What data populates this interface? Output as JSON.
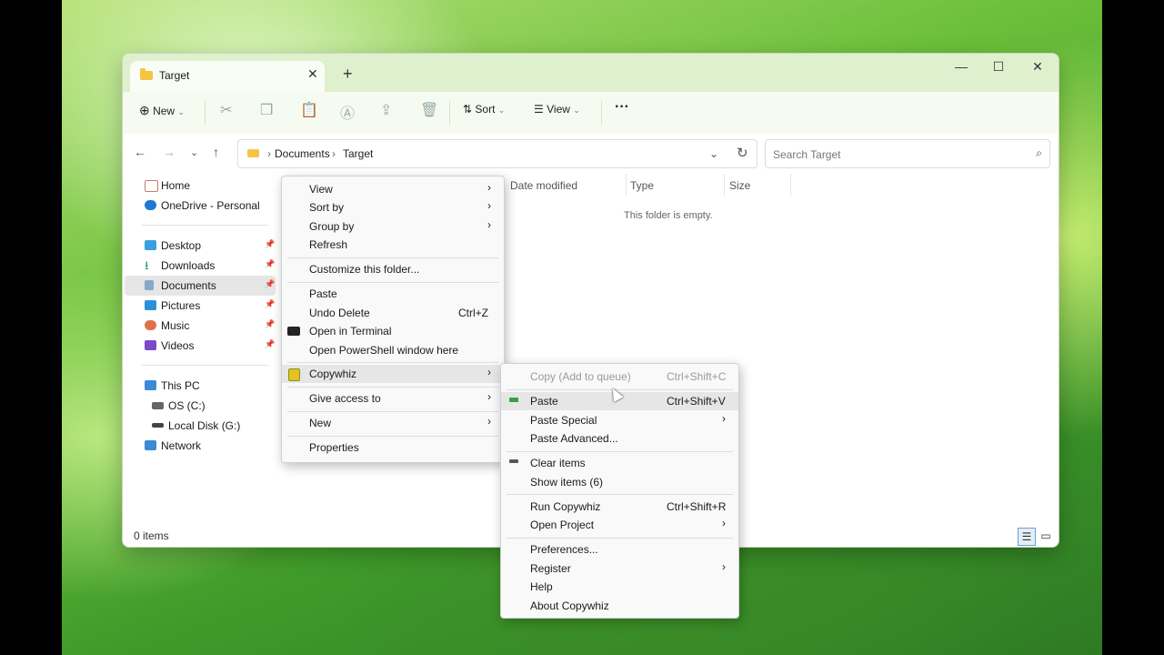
{
  "tab": {
    "title": "Target"
  },
  "toolbar": {
    "new_label": "New",
    "sort_label": "Sort",
    "view_label": "View",
    "more_label": "···"
  },
  "address": {
    "crumb1": "Documents",
    "crumb2": "Target"
  },
  "search": {
    "placeholder": "Search Target"
  },
  "sidebar": {
    "home": "Home",
    "onedrive": "OneDrive - Personal",
    "desktop": "Desktop",
    "downloads": "Downloads",
    "documents": "Documents",
    "pictures": "Pictures",
    "music": "Music",
    "videos": "Videos",
    "thispc": "This PC",
    "osc": "OS (C:)",
    "localg": "Local Disk (G:)",
    "network": "Network"
  },
  "columns": {
    "date": "Date modified",
    "type": "Type",
    "size": "Size"
  },
  "empty_text": "This folder is empty.",
  "status": {
    "items": "0 items"
  },
  "context_menu": {
    "view": "View",
    "sort_by": "Sort by",
    "group_by": "Group by",
    "refresh": "Refresh",
    "customize": "Customize this folder...",
    "paste": "Paste",
    "undo_delete": "Undo Delete",
    "undo_shortcut": "Ctrl+Z",
    "open_terminal": "Open in Terminal",
    "open_powershell": "Open PowerShell window here",
    "copywhiz": "Copywhiz",
    "give_access": "Give access to",
    "new": "New",
    "properties": "Properties"
  },
  "submenu": {
    "copy_queue": "Copy (Add to queue)",
    "copy_queue_sc": "Ctrl+Shift+C",
    "paste": "Paste",
    "paste_sc": "Ctrl+Shift+V",
    "paste_special": "Paste Special",
    "paste_advanced": "Paste Advanced...",
    "clear_items": "Clear items",
    "show_items": "Show items (6)",
    "run_copywhiz": "Run Copywhiz",
    "run_sc": "Ctrl+Shift+R",
    "open_project": "Open Project",
    "preferences": "Preferences...",
    "register": "Register",
    "help": "Help",
    "about": "About Copywhiz"
  }
}
